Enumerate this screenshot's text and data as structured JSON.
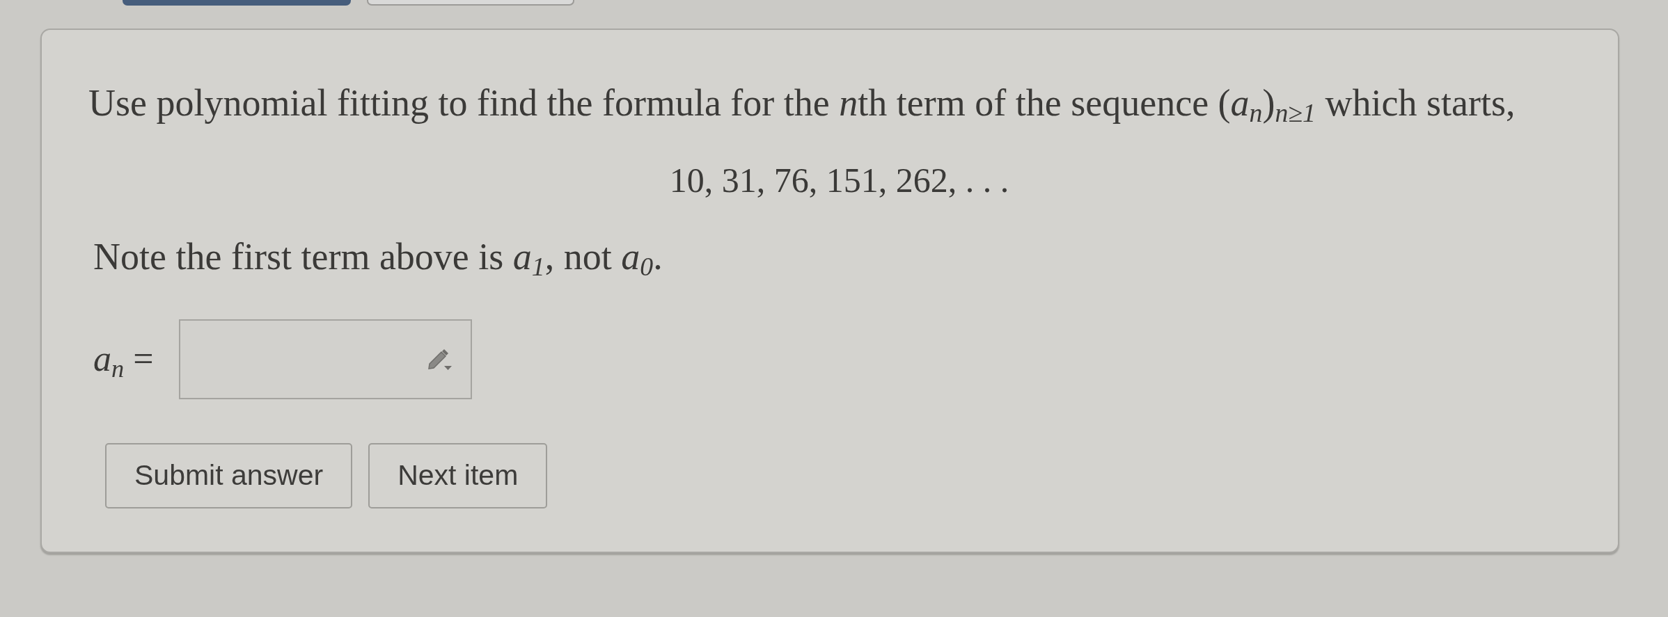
{
  "top_tabs": [
    {
      "selected": true
    },
    {
      "selected": false
    }
  ],
  "question": {
    "prompt": [
      "Use polynomial fitting to find the formula for the *n*",
      "th term of the sequence (*a*$_{n}$)$_{n≥1}$ which starts,"
    ],
    "sequence": "10, 31, 76, 151, 262, . . .",
    "note": "Note the first term above is *a*$_{1}$, not *a*$_{0}$."
  },
  "answer": {
    "label": "*a*$_{n}$ ="
  },
  "buttons": [
    "Submit answer",
    "Next item"
  ]
}
